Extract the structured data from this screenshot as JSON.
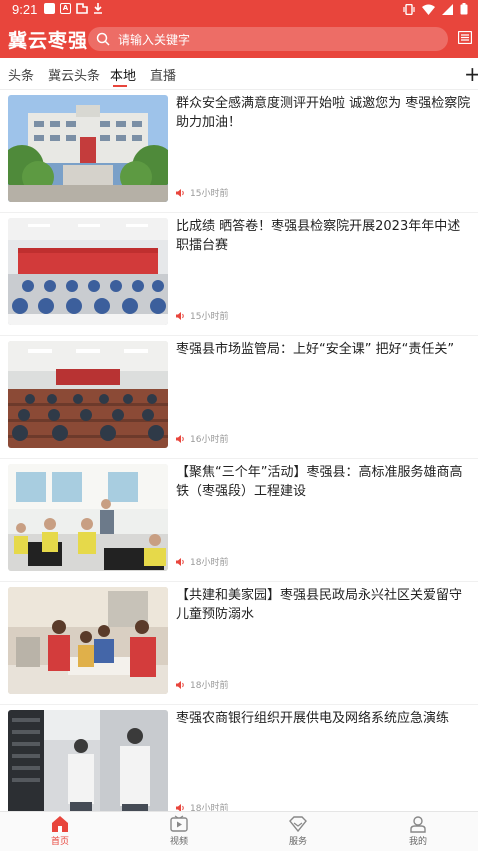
{
  "status_bar": {
    "time": "9:21"
  },
  "header": {
    "logo": "冀云枣强",
    "search_placeholder": "请输入关键字"
  },
  "tabs": [
    {
      "label": "头条"
    },
    {
      "label": "冀云头条"
    },
    {
      "label": "本地"
    },
    {
      "label": "直播"
    }
  ],
  "active_tab": "本地",
  "news": [
    {
      "title": "群众安全感满意度测评开始啦 诚邀您为 枣强检察院助力加油！",
      "time": "15小时前"
    },
    {
      "title": "比成绩 晒答卷！枣强县检察院开展2023年年中述职擂台赛",
      "time": "15小时前"
    },
    {
      "title": "枣强县市场监管局：上好“安全课” 把好“责任关”",
      "time": "16小时前"
    },
    {
      "title": "【聚焦“三个年”活动】枣强县：高标准服务雄商高铁（枣强段）工程建设",
      "time": "18小时前"
    },
    {
      "title": "【共建和美家园】枣强县民政局永兴社区关爱留守儿童预防溺水",
      "time": "18小时前"
    },
    {
      "title": "枣强农商银行组织开展供电及网络系统应急演练",
      "time": "18小时前"
    }
  ],
  "bottom_nav": [
    {
      "label": "首页",
      "icon": "home-icon"
    },
    {
      "label": "视频",
      "icon": "video-icon"
    },
    {
      "label": "服务",
      "icon": "diamond-icon"
    },
    {
      "label": "我的",
      "icon": "user-icon"
    }
  ],
  "colors": {
    "brand": "#e8453c"
  }
}
